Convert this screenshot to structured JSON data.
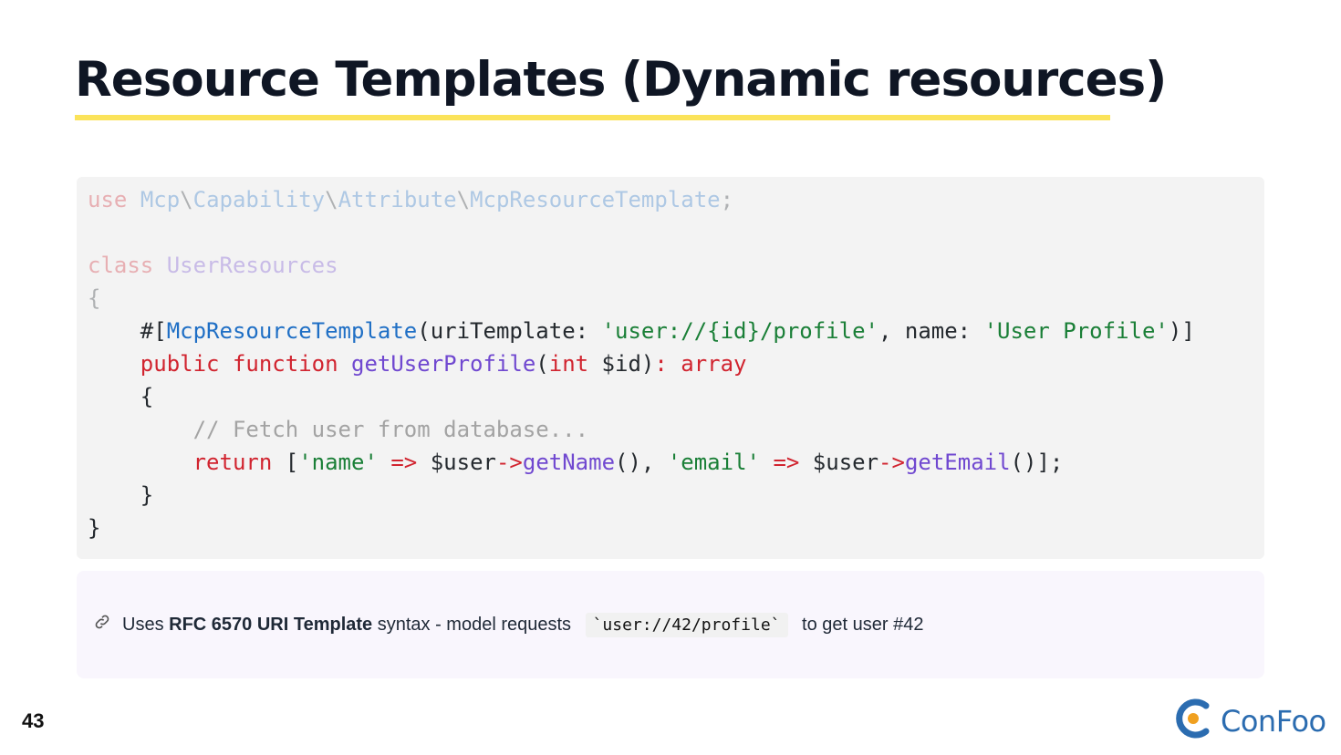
{
  "slide": {
    "title": "Resource Templates (Dynamic resources)",
    "page_number": "43",
    "logo_text": "ConFoo"
  },
  "code": {
    "l1": {
      "use": "use",
      "ns1": "Mcp",
      "s1": "\\",
      "ns2": "Capability",
      "s2": "\\",
      "ns3": "Attribute",
      "s3": "\\",
      "ns4": "McpResourceTemplate",
      "end": ";"
    },
    "l3": {
      "kw": "class",
      "name": "UserResources"
    },
    "l4": {
      "brace": "{"
    },
    "l5": {
      "pre": "    #[",
      "attr": "McpResourceTemplate",
      "p1": "(uriTemplate: ",
      "s1": "'user://{id}/profile'",
      "p2": ", name: ",
      "s2": "'User Profile'",
      "p3": ")]"
    },
    "l6": {
      "pre": "    ",
      "k1": "public",
      "sp1": " ",
      "k2": "function",
      "sp2": " ",
      "fn": "getUserProfile",
      "p1": "(",
      "k3": "int",
      "p2": " $id)",
      "k4": ": array"
    },
    "l7": {
      "text": "    {"
    },
    "l8": {
      "text": "        // Fetch user from database..."
    },
    "l9": {
      "pre": "        ",
      "k1": "return",
      "p1": " [",
      "s1": "'name'",
      "sp1": " ",
      "op1": "=>",
      "p2": " $user",
      "op2": "->",
      "fn1": "getName",
      "p3": "(), ",
      "s2": "'email'",
      "sp2": " ",
      "op3": "=>",
      "p4": " $user",
      "op4": "->",
      "fn2": "getEmail",
      "p5": "()];"
    },
    "l10": {
      "text": "    }"
    },
    "l11": {
      "text": "}"
    }
  },
  "note": {
    "icon": "link-icon",
    "prefix": "Uses ",
    "strong": "RFC 6570 URI Template",
    "middle": " syntax - model requests ",
    "code": "`user://42/profile`",
    "suffix": " to get user #42"
  },
  "colors": {
    "title_underline": "#fbe35a",
    "code_bg": "#f3f3f3",
    "note_bg": "#f9f6fd",
    "keyword": "#d1242f",
    "string": "#1a7f37",
    "function": "#7048d0",
    "attribute": "#1f6fc5",
    "logo": "#2b6cb0"
  }
}
